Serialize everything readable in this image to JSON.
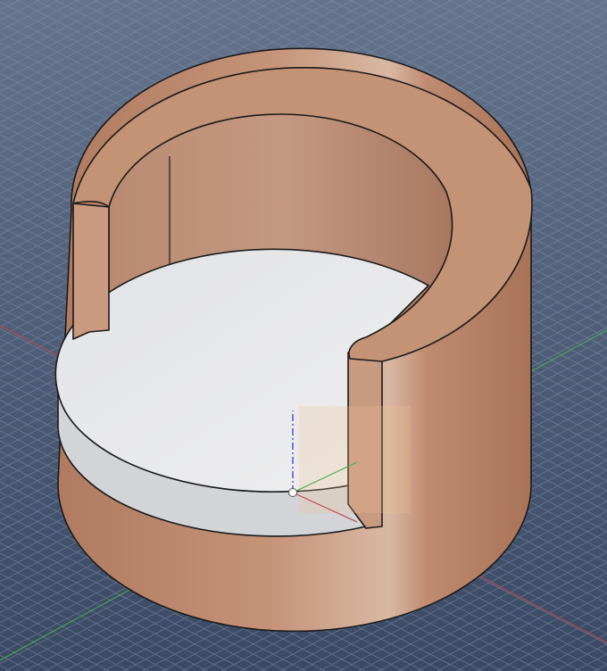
{
  "viewport": {
    "view": "isometric",
    "colors": {
      "background_top": "#62718a",
      "background_bottom": "#3c4b66",
      "grid": "#8090a8",
      "body": "#b8856a",
      "body_light": "#c99a80",
      "floor": "#e6e7e9",
      "floor_side": "#d2d3d6",
      "x_axis": "#c0474a",
      "y_axis": "#4caf50",
      "z_axis": "#4a5ad0"
    }
  }
}
